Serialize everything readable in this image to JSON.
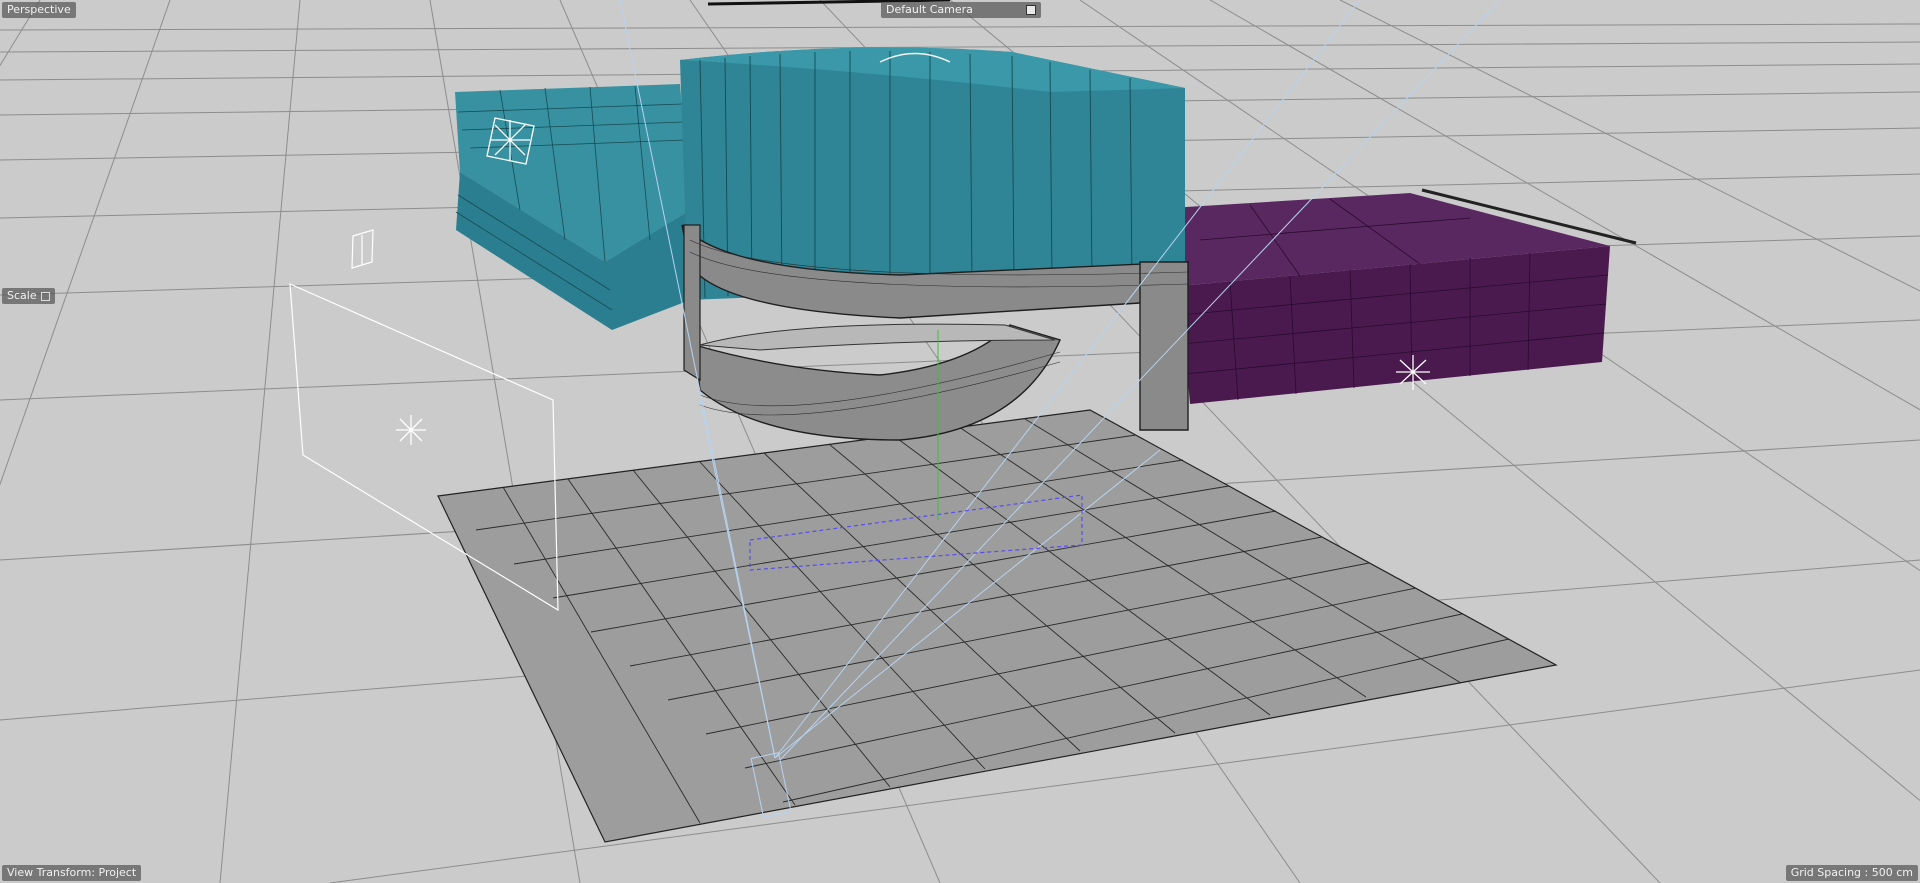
{
  "viewport": {
    "view_label": "Perspective",
    "camera_label": "Default Camera",
    "scale_label": "Scale",
    "transform_label": "View Transform: Project",
    "grid_spacing_label": "Grid Spacing : 500 cm"
  },
  "colors": {
    "background": "#cbcbcb",
    "grid_line": "#8c8c8c",
    "teal_volume": "#2a7e8f",
    "purple_volume": "#4a1a4e",
    "ground_plane": "#9d9d9d",
    "camera_frustum": "#b7d3f0",
    "selection_box": "#5a4cf0"
  },
  "icons": {
    "camera_menu": "square-button-icon",
    "scale_toggle": "checkbox-icon",
    "lights": "light-star-icon"
  }
}
